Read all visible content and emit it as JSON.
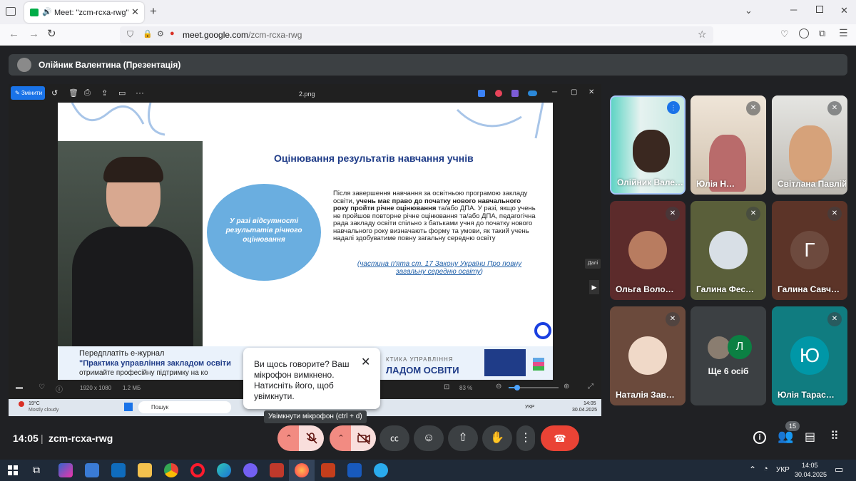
{
  "browser": {
    "tab_title": "Meet: \"zcm-rcxa-rwg\"",
    "url_domain": "meet.google.com",
    "url_path": "/zcm-rcxa-rwg"
  },
  "meet": {
    "presenter_label": "Олійник Валентина (Презентація)",
    "time": "14:05",
    "separator": "|",
    "meeting_code": "zcm-rcxa-rwg",
    "people_count": "15",
    "mic_tooltip": "Увімкнути мікрофон (ctrl + d)",
    "popup": {
      "text": "Ви щось говорите? Ваш мікрофон вимкнено. Натисніть його, щоб увімкнути."
    },
    "next_label": "Далі"
  },
  "viewer": {
    "edit_label": "Змінити",
    "file_name": "2.png",
    "dimensions": "1920 x 1080",
    "file_size": "1.2 МБ",
    "zoom": "83 %"
  },
  "slide": {
    "title": "Оцінювання результатів навчання учнів",
    "ellipse_text": "У разі відсутності результатів річного оцінювання",
    "body_plain1": "Після завершення навчання за освітньою програмою закладу освіти, ",
    "body_bold": "учень має право до початку нового навчального року пройти річне оцінювання",
    "body_plain2": " та/або ДПА. У разі, якщо учень не пройшов повторне річне оцінювання та/або ДПА, педагогічна рада закладу освіти спільно з батьками учня до початку нового навчального року визначають форму та умови, як такий учень надалі здобуватиме повну загальну середню освіту",
    "paren_open": "(",
    "reference": "частина п'ята ст. 17 Закону України Про повну загальну середню освіту",
    "paren_close": ")",
    "banner_line1": "Передплатіть е-журнал",
    "banner_line2": "\"Практика управління закладом освіти",
    "banner_line3": "отримайте професійну підтримку на ко",
    "banner_right1": "КТИКА УПРАВЛІННЯ",
    "banner_right2": "ЛАДОМ ОСВІТИ"
  },
  "shared_taskbar": {
    "weather_temp": "19°C",
    "weather_desc": "Mostly cloudy",
    "search": "Пошук",
    "lang": "УКР",
    "time": "14:05",
    "date": "30.04.2025"
  },
  "participants": [
    {
      "name": "Олійник Вале…",
      "speaking": true
    },
    {
      "name": "Юлія Н…",
      "muted": true
    },
    {
      "name": "Світлана Павлій",
      "muted": true
    },
    {
      "name": "Ольга Воло…",
      "muted": true
    },
    {
      "name": "Галина Фес…",
      "muted": true
    },
    {
      "name": "Галина Савч…",
      "initial": "Г",
      "muted": true
    },
    {
      "name": "Наталія Зав…",
      "muted": true
    },
    {
      "name": "Ще 6 осіб",
      "initial": "Л"
    },
    {
      "name": "Юлія Тарас…",
      "initial": "Ю",
      "muted": true
    }
  ],
  "taskbar": {
    "lang": "УКР",
    "time": "14:05",
    "date": "30.04.2025"
  },
  "colors": {
    "end_call": "#ea4335",
    "muted_control": "#f9dedc",
    "slide_title": "#1f3c88",
    "ellipse": "#6aaee0"
  }
}
